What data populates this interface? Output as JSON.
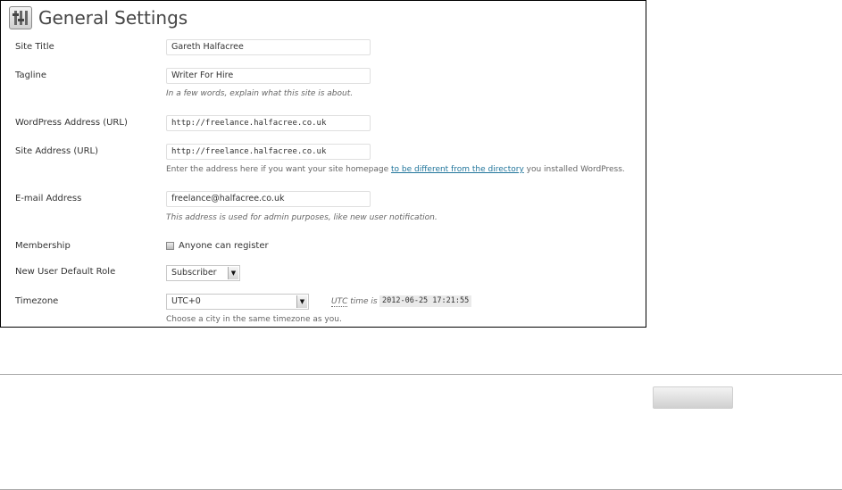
{
  "header": {
    "icon": "settings-sliders-icon",
    "title": "General Settings"
  },
  "fields": {
    "site_title": {
      "label": "Site Title",
      "value": "Gareth Halfacree"
    },
    "tagline": {
      "label": "Tagline",
      "value": "Writer For Hire",
      "description": "In a few words, explain what this site is about."
    },
    "wp_address": {
      "label": "WordPress Address (URL)",
      "value": "http://freelance.halfacree.co.uk"
    },
    "site_address": {
      "label": "Site Address (URL)",
      "value": "http://freelance.halfacree.co.uk",
      "description_before": "Enter the address here if you want your site homepage ",
      "description_link": "to be different from the directory",
      "description_after": " you installed WordPress."
    },
    "email": {
      "label": "E-mail Address",
      "value": "freelance@halfacree.co.uk",
      "description": "This address is used for admin purposes, like new user notification."
    },
    "membership": {
      "label": "Membership",
      "checkbox_label": "Anyone can register",
      "checked": false
    },
    "default_role": {
      "label": "New User Default Role",
      "selected": "Subscriber"
    },
    "timezone": {
      "label": "Timezone",
      "selected": "UTC+0",
      "utc_abbr": "UTC",
      "utc_text": " time is",
      "utc_time": "2012-06-25 17:21:55",
      "description": "Choose a city in the same timezone as you."
    }
  },
  "colors": {
    "link": "#21759b",
    "title": "#464646"
  }
}
